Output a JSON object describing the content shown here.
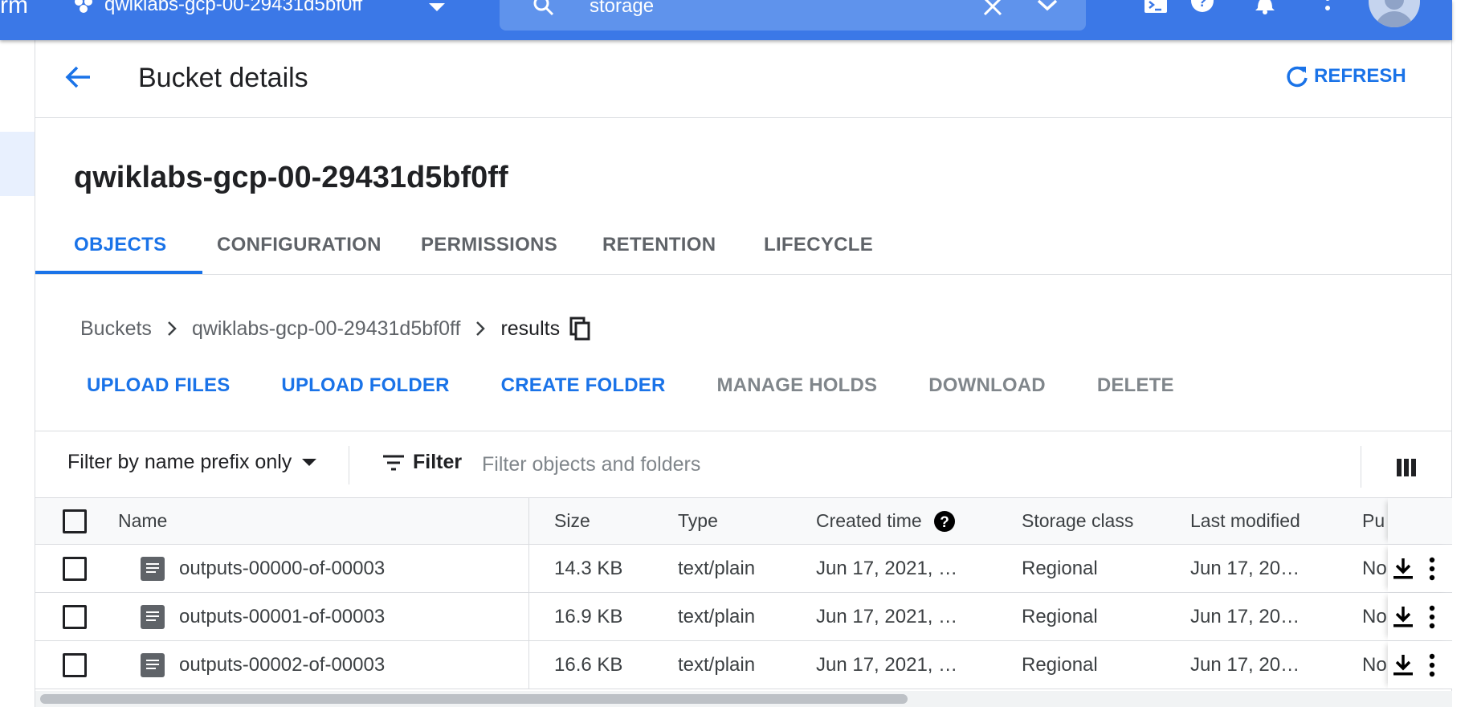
{
  "topbar": {
    "app_fragment": "rm",
    "project_name": "qwiklabs-gcp-00-29431d5bf0ff",
    "search_value": "storage",
    "icons": [
      "cloud-shell-icon",
      "help-icon",
      "notifications-icon",
      "more-vert-icon",
      "account-avatar-icon"
    ],
    "brand_color": "#3b78e7"
  },
  "header": {
    "title": "Bucket details",
    "refresh_label": "REFRESH"
  },
  "bucket": {
    "name": "qwiklabs-gcp-00-29431d5bf0ff"
  },
  "tabs": [
    {
      "label": "OBJECTS",
      "active": true
    },
    {
      "label": "CONFIGURATION",
      "active": false
    },
    {
      "label": "PERMISSIONS",
      "active": false
    },
    {
      "label": "RETENTION",
      "active": false
    },
    {
      "label": "LIFECYCLE",
      "active": false
    }
  ],
  "breadcrumb": {
    "root": "Buckets",
    "bucket": "qwiklabs-gcp-00-29431d5bf0ff",
    "current": "results"
  },
  "actions": [
    {
      "label": "UPLOAD FILES",
      "enabled": true
    },
    {
      "label": "UPLOAD FOLDER",
      "enabled": true
    },
    {
      "label": "CREATE FOLDER",
      "enabled": true
    },
    {
      "label": "MANAGE HOLDS",
      "enabled": false
    },
    {
      "label": "DOWNLOAD",
      "enabled": false
    },
    {
      "label": "DELETE",
      "enabled": false
    }
  ],
  "filter": {
    "prefix_mode": "Filter by name prefix only",
    "label": "Filter",
    "placeholder": "Filter objects and folders"
  },
  "table": {
    "columns": [
      "Name",
      "Size",
      "Type",
      "Created time",
      "Storage class",
      "Last modified",
      "Pu"
    ],
    "rows": [
      {
        "name": "outputs-00000-of-00003",
        "size": "14.3 KB",
        "type": "text/plain",
        "created": "Jun 17, 2021, …",
        "storage_class": "Regional",
        "modified": "Jun 17, 20…",
        "public": "No"
      },
      {
        "name": "outputs-00001-of-00003",
        "size": "16.9 KB",
        "type": "text/plain",
        "created": "Jun 17, 2021, …",
        "storage_class": "Regional",
        "modified": "Jun 17, 20…",
        "public": "No"
      },
      {
        "name": "outputs-00002-of-00003",
        "size": "16.6 KB",
        "type": "text/plain",
        "created": "Jun 17, 2021, …",
        "storage_class": "Regional",
        "modified": "Jun 17, 20…",
        "public": "No"
      }
    ]
  },
  "colors": {
    "accent": "#1a73e8",
    "disabled": "#80868b",
    "divider": "#dadce0"
  }
}
